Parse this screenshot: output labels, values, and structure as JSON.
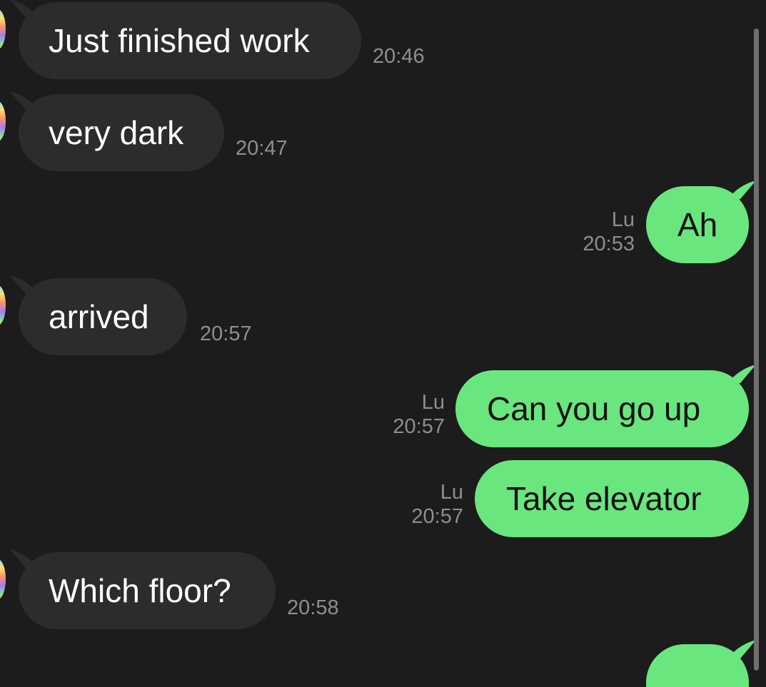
{
  "messages": [
    {
      "text": "Just finished work",
      "time": "20:46"
    },
    {
      "text": "very dark",
      "time": "20:47"
    },
    {
      "text": "Ah",
      "sender": "Lu",
      "time": "20:53"
    },
    {
      "text": "arrived",
      "time": "20:57"
    },
    {
      "text": "Can you go up",
      "sender": "Lu",
      "time": "20:57"
    },
    {
      "text": "Take elevator",
      "sender": "Lu",
      "time": "20:57"
    },
    {
      "text": "Which floor?",
      "time": "20:58"
    }
  ],
  "colors": {
    "background": "#1c1c1c",
    "incoming_bubble": "#2c2c2c",
    "outgoing_bubble": "#6ae67e",
    "timestamp": "#8e8e8e"
  }
}
